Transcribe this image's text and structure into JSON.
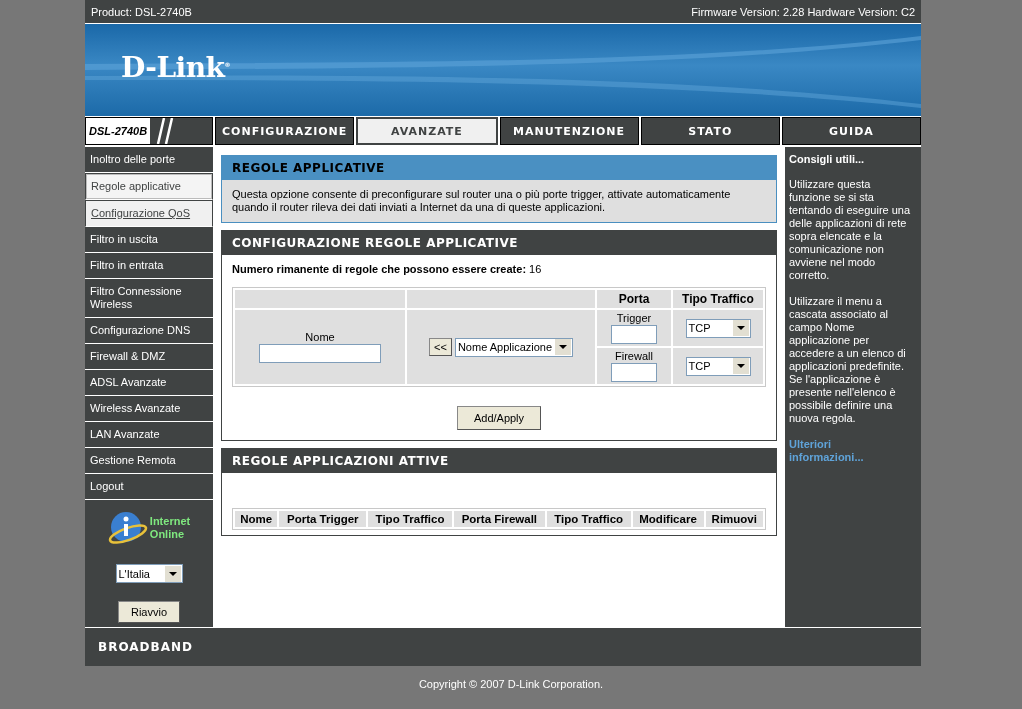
{
  "top_bar": {
    "product": "Product: DSL-2740B",
    "versions": "Firmware Version: 2.28 Hardware Version: C2"
  },
  "banner": {
    "logo": "D-Link",
    "registered": "®"
  },
  "nav": {
    "model": "DSL-2740B",
    "tabs": [
      {
        "label": "CONFIGURAZIONE",
        "selected": false
      },
      {
        "label": "AVANZATE",
        "selected": true
      },
      {
        "label": "MANUTENZIONE",
        "selected": false
      },
      {
        "label": "STATO",
        "selected": false
      },
      {
        "label": "GUIDA",
        "selected": false
      }
    ]
  },
  "sidebar": {
    "items": [
      {
        "label": "Inoltro delle porte",
        "selected": false,
        "hovered": false
      },
      {
        "label": "Regole applicative",
        "selected": true,
        "hovered": false
      },
      {
        "label": "Configurazione QoS",
        "selected": false,
        "hovered": true
      },
      {
        "label": "Filtro in uscita",
        "selected": false,
        "hovered": false
      },
      {
        "label": "Filtro in entrata",
        "selected": false,
        "hovered": false
      },
      {
        "label": "Filtro Connessione Wireless",
        "selected": false,
        "hovered": false
      },
      {
        "label": "Configurazione DNS",
        "selected": false,
        "hovered": false
      },
      {
        "label": "Firewall & DMZ",
        "selected": false,
        "hovered": false
      },
      {
        "label": "ADSL Avanzate",
        "selected": false,
        "hovered": false
      },
      {
        "label": "Wireless Avanzate",
        "selected": false,
        "hovered": false
      },
      {
        "label": "LAN Avanzate",
        "selected": false,
        "hovered": false
      },
      {
        "label": "Gestione Remota",
        "selected": false,
        "hovered": false
      },
      {
        "label": "Logout",
        "selected": false,
        "hovered": false
      }
    ],
    "status": "Internet\nOnline",
    "language": "L'Italia",
    "reboot_button": "Riavvio"
  },
  "intro": {
    "title": "REGOLE APPLICATIVE",
    "text": "Questa opzione consente di preconfigurare sul router una o più porte trigger, attivate automaticamente quando il router rileva dei dati inviati a Internet da una di queste applicazioni."
  },
  "config": {
    "title": "CONFIGURAZIONE REGOLE APPLICATIVE",
    "remaining_label": "Numero rimanente di regole che possono essere create:",
    "remaining": "16",
    "headers": {
      "porta": "Porta",
      "tipo": "Tipo Traffico"
    },
    "name_label": "Nome",
    "copy_button": "<<",
    "app_select": "Nome Applicazione",
    "ports": [
      {
        "label": "Trigger",
        "protocol": "TCP"
      },
      {
        "label": "Firewall",
        "protocol": "TCP"
      }
    ],
    "apply_button": "Add/Apply"
  },
  "active": {
    "title": "REGOLE APPLICAZIONI ATTIVE",
    "columns": [
      "Nome",
      "Porta Trigger",
      "Tipo Traffico",
      "Porta Firewall",
      "Tipo Traffico",
      "Modificare",
      "Rimuovi"
    ]
  },
  "hints": {
    "title": "Consigli utili...",
    "paragraphs": [
      "Utilizzare questa funzione se si sta tentando di eseguire una delle applicazioni di rete sopra elencate e la comunicazione non avviene nel modo corretto.",
      "Utilizzare il menu a cascata associato al campo Nome applicazione per accedere a un elenco di applicazioni predefinite. Se l'applicazione è presente nell'elenco è possibile definire una nuova regola."
    ],
    "more_link": "Ulteriori informazioni..."
  },
  "footer": {
    "brand": "BROADBAND",
    "copyright": "Copyright © 2007 D-Link Corporation."
  }
}
